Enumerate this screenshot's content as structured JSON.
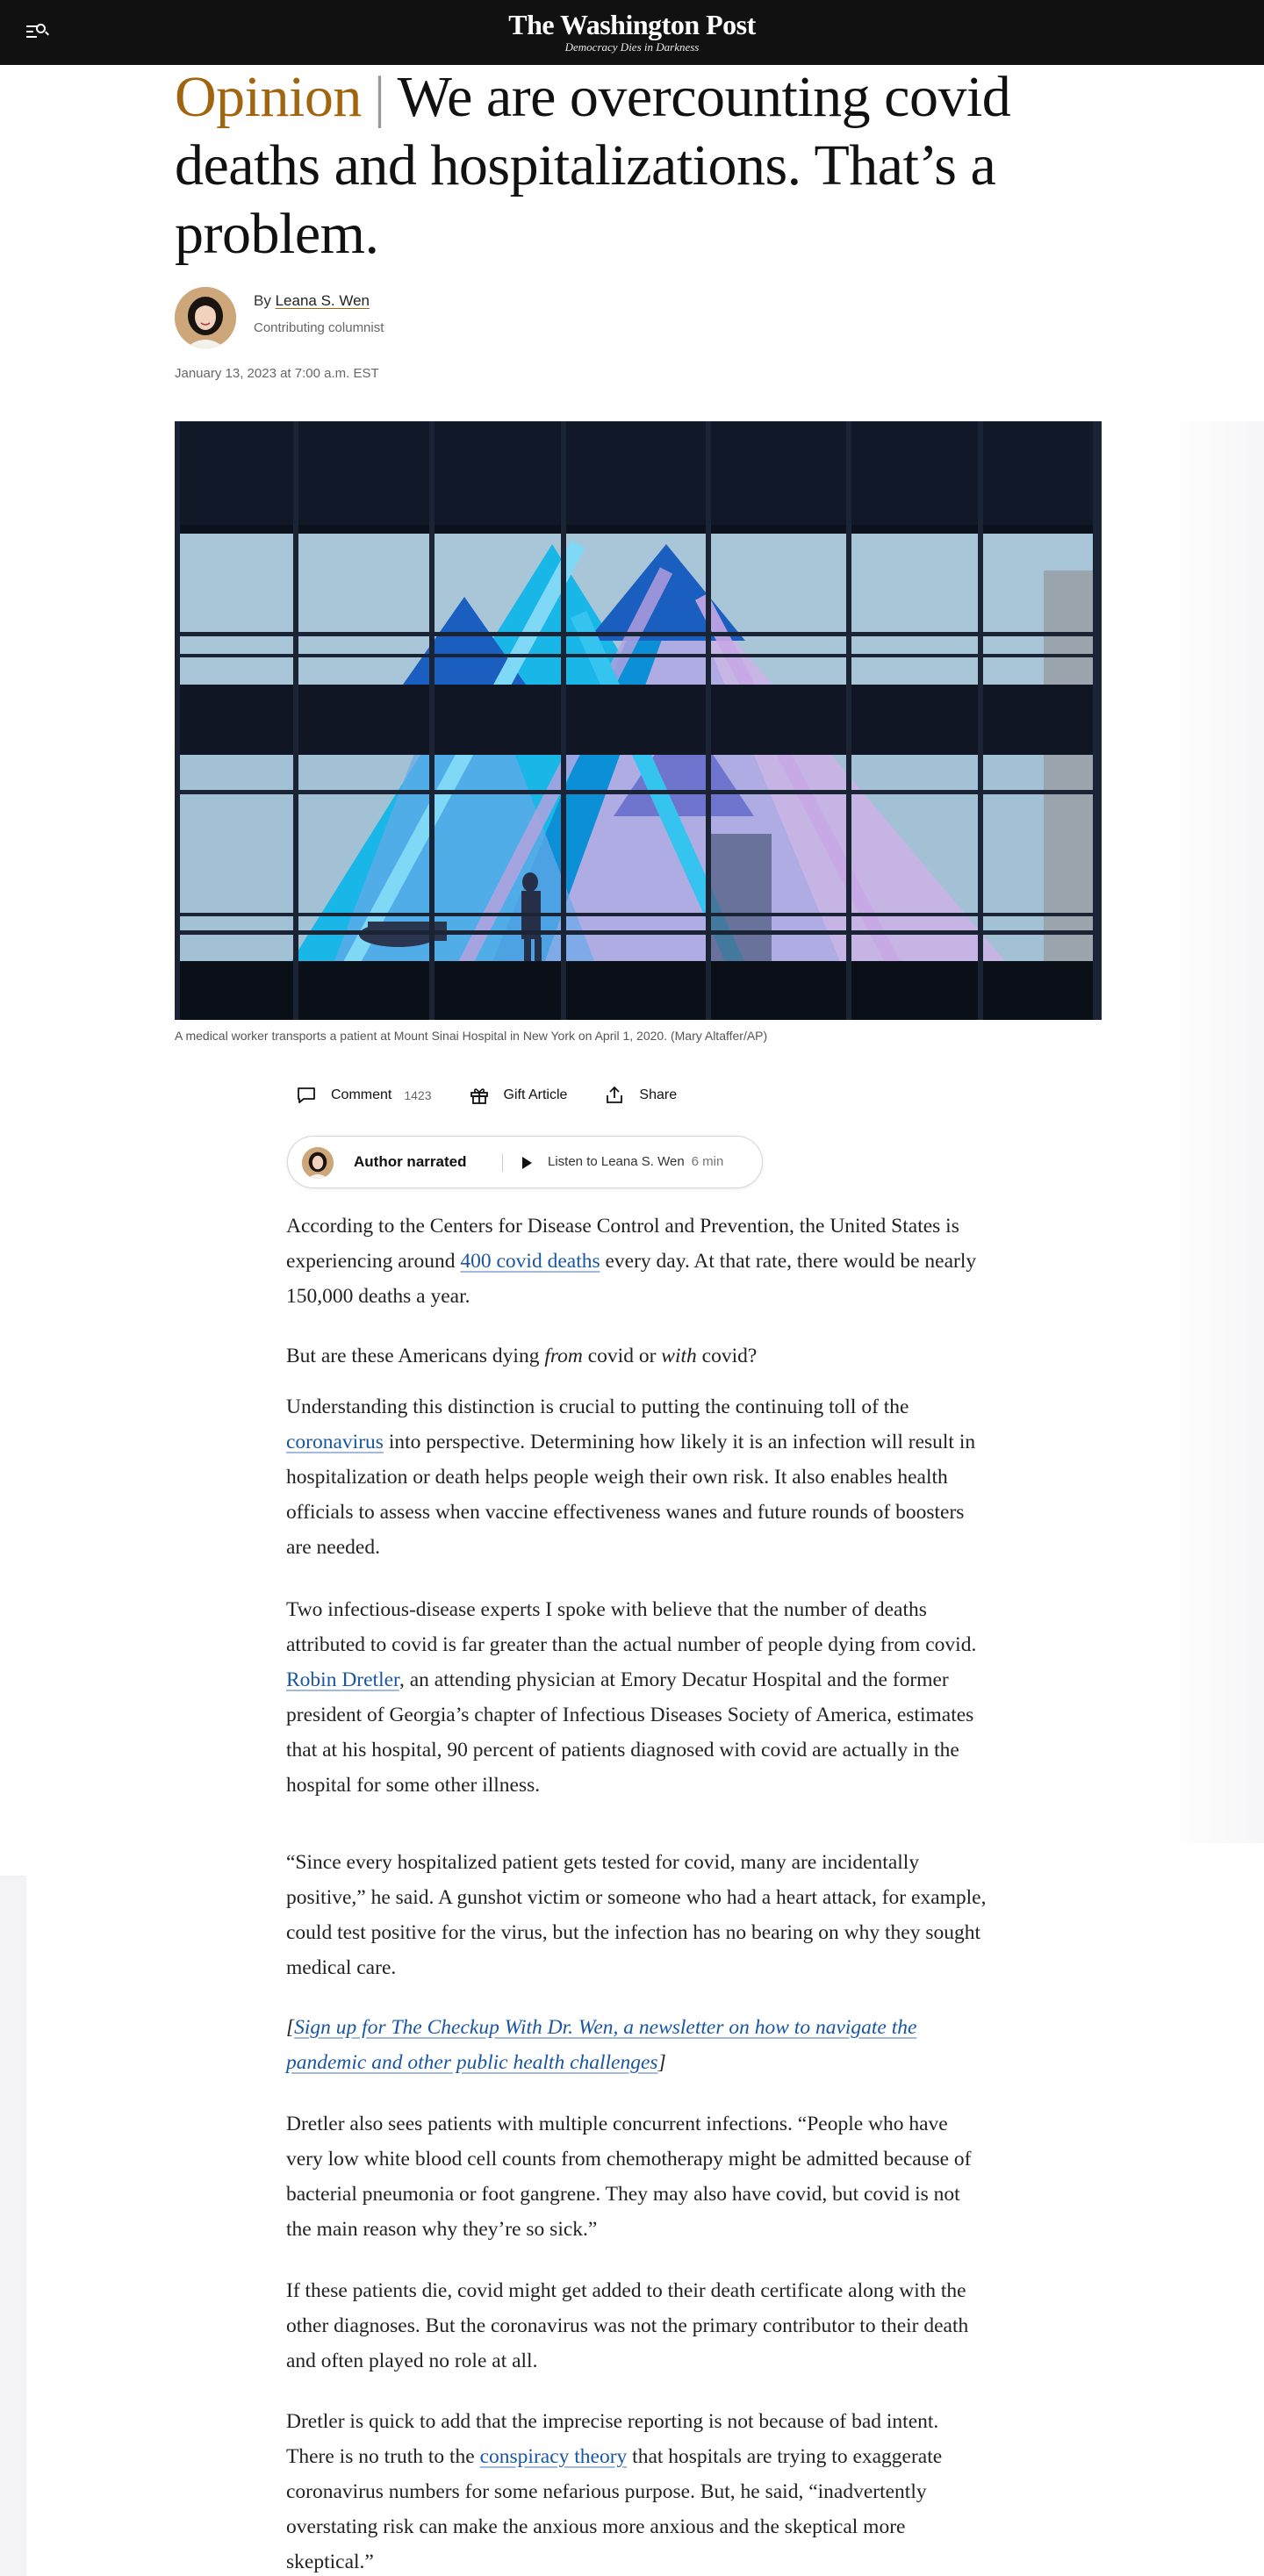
{
  "header": {
    "logo_name": "The Washington Post",
    "logo_tagline": "Democracy Dies in Darkness"
  },
  "article": {
    "kicker": "Opinion",
    "separator": "|",
    "title": "We are overcounting covid deaths and hospitalizations. That’s a problem.",
    "byline_prefix": "By",
    "author": "Leana S. Wen",
    "author_role": "Contributing columnist",
    "date": "January 13, 2023 at 7:00 a.m. EST",
    "photo_caption": "A medical worker transports a patient at Mount Sinai Hospital in New York on April 1, 2020. (Mary Altaffer/AP)"
  },
  "actions": {
    "comment_label": "Comment",
    "comment_count": "1423",
    "gift_label": "Gift Article",
    "share_label": "Share"
  },
  "audio": {
    "badge": "Author narrated",
    "listen_label": "Listen to Leana S. Wen",
    "duration": "6 min"
  },
  "body": {
    "p1_a": "According to the Centers for Disease Control and Prevention, the United States is experiencing around ",
    "p1_link": "400 covid deaths",
    "p1_b": " every day. At that rate, there would be nearly 150,000 deaths a year.",
    "p2_a": "But are these Americans dying ",
    "p2_em1": "from",
    "p2_b": " covid or ",
    "p2_em2": "with",
    "p2_c": " covid?",
    "p3_a": "Understanding this distinction is crucial to putting the continuing toll of the ",
    "p3_link": "coronavirus",
    "p3_b": " into perspective. Determining how likely it is an infection will result in hospitalization or death helps people weigh their own risk. It also enables health officials to assess when vaccine effectiveness wanes and future rounds of boosters are needed.",
    "p4_a": "Two infectious-disease experts I spoke with believe that the number of deaths attributed to covid is far greater than the actual number of people dying from covid. ",
    "p4_link": "Robin Dretler",
    "p4_b": ", an attending physician at Emory Decatur Hospital and the former president of Georgia’s chapter of Infectious Diseases Society of America, estimates that at his hospital, 90 percent of patients diagnosed with covid are actually in the hospital for some other illness.",
    "p5": "“Since every hospitalized patient gets tested for covid, many are incidentally positive,” he said. A gunshot victim or someone who had a heart attack, for example, could test positive for the virus, but the infection has no bearing on why they sought medical care.",
    "p6_open": "[",
    "p6_link": "Sign up for The Checkup With Dr. Wen, a newsletter on how to navigate the pandemic and other public health challenges",
    "p6_close": "]",
    "p7": "Dretler also sees patients with multiple concurrent infections. “People who have very low white blood cell counts from chemotherapy might be admitted because of bacterial pneumonia or foot gangrene. They may also have covid, but covid is not the main reason why they’re so sick.”",
    "p8": "If these patients die, covid might get added to their death certificate along with the other diagnoses. But the coronavirus was not the primary contributor to their death and often played no role at all.",
    "p9_a": "Dretler is quick to add that the imprecise reporting is not because of bad intent. There is no truth to the ",
    "p9_link": "conspiracy theory",
    "p9_b": " that hospitals are trying to exaggerate coronavirus numbers for some nefarious purpose. But, he said, “inadvertently overstating risk can make the anxious more anxious and the skeptical more skeptical.”"
  },
  "colors": {
    "kicker": "#a1650f",
    "link": "#1955a5",
    "header_bg": "#111111"
  },
  "icons": [
    "menu-search-icon",
    "comment-icon",
    "gift-icon",
    "share-icon",
    "play-icon"
  ]
}
